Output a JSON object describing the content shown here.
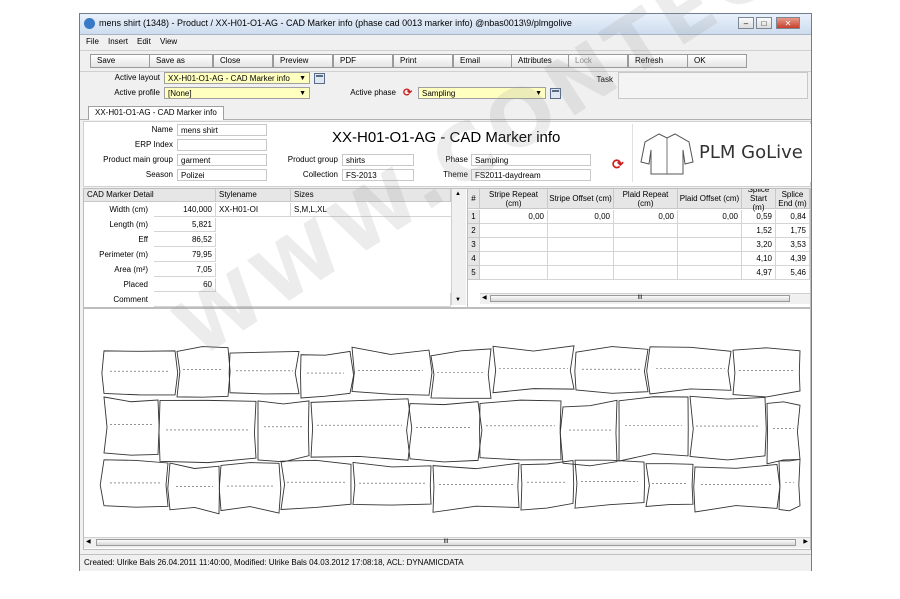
{
  "window": {
    "title": "mens shirt (1348) - Product / XX-H01-O1-AG - CAD Marker info (phase cad 0013 marker info) @nbas0013\\9/plmgolive"
  },
  "menu": [
    "File",
    "Insert",
    "Edit",
    "View"
  ],
  "toolbar": {
    "buttons": [
      "Save",
      "Save as",
      "Close",
      "Preview",
      "PDF",
      "Print",
      "Email",
      "Attributes",
      "Lock",
      "Refresh",
      "OK"
    ]
  },
  "header": {
    "active_layout_label": "Active layout",
    "active_layout_value": "XX-H01-O1-AG - CAD Marker info",
    "active_profile_label": "Active profile",
    "active_profile_value": "[None]",
    "active_phase_label": "Active phase",
    "active_phase_value": "Sampling",
    "task_label": "Task"
  },
  "tab": {
    "label": "XX-H01-O1-AG - CAD Marker info"
  },
  "info": {
    "title": "XX-H01-O1-AG - CAD Marker info",
    "name_label": "Name",
    "name_value": "mens shirt",
    "erp_label": "ERP Index",
    "erp_value": "",
    "pmg_label": "Product main group",
    "pmg_value": "garment",
    "season_label": "Season",
    "season_value": "Polizei",
    "pg_label": "Product group",
    "pg_value": "shirts",
    "collection_label": "Collection",
    "collection_value": "FS-2013",
    "phase_label": "Phase",
    "phase_value": "Sampling",
    "theme_label": "Theme",
    "theme_value": "FS2011-daydream",
    "logo_text": "PLM GoLive"
  },
  "cad": {
    "header": "CAD Marker Detail",
    "stylename_header": "Stylename",
    "sizes_header": "Sizes",
    "stylename": "XX-H01-OI",
    "sizes": "S,M,L,XL",
    "rows": [
      {
        "label": "Width (cm)",
        "value": "140,000"
      },
      {
        "label": "Length (m)",
        "value": "5,821"
      },
      {
        "label": "Eff",
        "value": "86,52"
      },
      {
        "label": "Perimeter (m)",
        "value": "79,95"
      },
      {
        "label": "Area (m²)",
        "value": "7,05"
      },
      {
        "label": "Placed",
        "value": "60"
      },
      {
        "label": "Comment",
        "value": ""
      }
    ]
  },
  "splice": {
    "headers": [
      "#",
      "Stripe Repeat (cm)",
      "Stripe Offset (cm)",
      "Plaid Repeat (cm)",
      "Plaid Offset (cm)",
      "Splice Start (m)",
      "Splice End (m)"
    ],
    "rows": [
      [
        "1",
        "0,00",
        "0,00",
        "0,00",
        "0,00",
        "0,59",
        "0,84"
      ],
      [
        "2",
        "",
        "",
        "",
        "",
        "1,52",
        "1,75"
      ],
      [
        "3",
        "",
        "",
        "",
        "",
        "3,20",
        "3,53"
      ],
      [
        "4",
        "",
        "",
        "",
        "",
        "4,10",
        "4,39"
      ],
      [
        "5",
        "",
        "",
        "",
        "",
        "4,97",
        "5,46"
      ]
    ]
  },
  "scroll": {
    "thumb_label": "III"
  },
  "watermark": "WWW.CONTEC.PL",
  "status": "Created: Ulrike Bals 26.04.2011 11:40:00, Modified: Ulrike Bals 04.03.2012 17:08:18, ACL: DYNAMICDATA"
}
